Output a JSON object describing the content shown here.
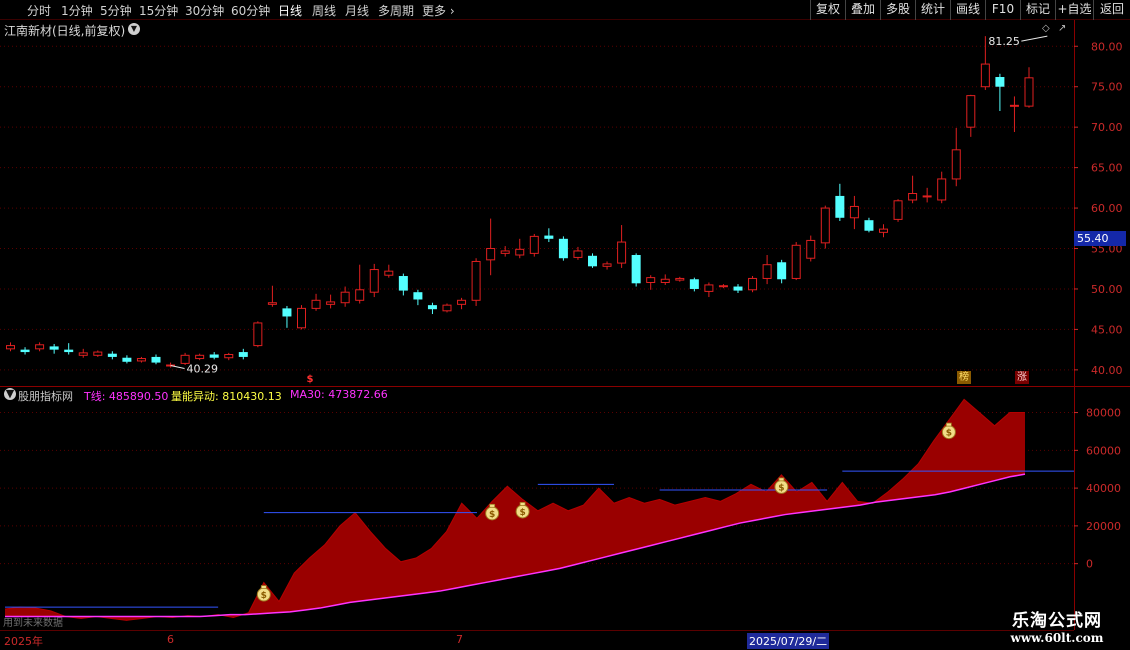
{
  "toolbar": {
    "periods": [
      {
        "label": "分时",
        "active": false
      },
      {
        "label": "1分钟",
        "active": false
      },
      {
        "label": "5分钟",
        "active": false
      },
      {
        "label": "15分钟",
        "active": false
      },
      {
        "label": "30分钟",
        "active": false
      },
      {
        "label": "60分钟",
        "active": false
      },
      {
        "label": "日线",
        "active": true
      },
      {
        "label": "周线",
        "active": false
      },
      {
        "label": "月线",
        "active": false
      },
      {
        "label": "多周期",
        "active": false
      },
      {
        "label": "更多",
        "active": false
      }
    ],
    "buttons": [
      "复权",
      "叠加",
      "多股",
      "统计",
      "画线",
      "F10",
      "标记",
      "+自选",
      "返回"
    ]
  },
  "stock": {
    "title": "江南新材(日线,前复权)",
    "current_price": "55.40",
    "high_label": "81.25",
    "low_label": "40.29"
  },
  "indicator": {
    "name": "股朋指标网",
    "t_line": "T线: 485890.50",
    "volume_spike": "量能异动: 810430.13",
    "ma30": "MA30: 473872.66",
    "no_data_note": "用到未来数据"
  },
  "colors": {
    "up": "#e02020",
    "down": "#54ffff",
    "grid": "#5a0000",
    "t_fill": "#9a0000",
    "ma30": "#ff33ff",
    "level_line": "#3355ff",
    "axis_text": "#cc2a2a",
    "indicator_name": "#c8c8c8",
    "t_label": "#ff33ff",
    "volume_label": "#ffff44"
  },
  "badges": {
    "dollar": "$",
    "bang": "榜",
    "zhang": "涨"
  },
  "dates": {
    "year": "2025年",
    "june": "6",
    "july": "7",
    "cursor": "2025/07/29/二"
  },
  "watermark": {
    "name": "乐淘公式网",
    "url": "www.60lt.com"
  },
  "chart_data": [
    {
      "type": "candlestick",
      "title": "江南新材(日线,前复权)",
      "y_ticks": [
        "40.00",
        "45.00",
        "50.00",
        "55.00",
        "60.00",
        "65.00",
        "70.00",
        "75.00",
        "80.00"
      ],
      "ylim": [
        38.5,
        83
      ],
      "candles": [
        {
          "o": 42.6,
          "c": 43.0,
          "h": 43.4,
          "l": 42.3
        },
        {
          "o": 42.5,
          "c": 42.2,
          "h": 42.8,
          "l": 41.9
        },
        {
          "o": 42.6,
          "c": 43.1,
          "h": 43.4,
          "l": 42.3
        },
        {
          "o": 42.9,
          "c": 42.5,
          "h": 43.2,
          "l": 42.0
        },
        {
          "o": 42.5,
          "c": 42.2,
          "h": 43.3,
          "l": 41.9
        },
        {
          "o": 41.8,
          "c": 42.1,
          "h": 42.6,
          "l": 41.5
        },
        {
          "o": 41.8,
          "c": 42.2,
          "h": 42.4,
          "l": 41.6
        },
        {
          "o": 42.0,
          "c": 41.6,
          "h": 42.3,
          "l": 41.3
        },
        {
          "o": 41.5,
          "c": 41.0,
          "h": 41.8,
          "l": 40.8
        },
        {
          "o": 41.1,
          "c": 41.4,
          "h": 41.6,
          "l": 40.9
        },
        {
          "o": 41.6,
          "c": 40.9,
          "h": 41.9,
          "l": 40.7
        },
        {
          "o": 40.6,
          "c": 40.6,
          "h": 40.9,
          "l": 40.29
        },
        {
          "o": 40.8,
          "c": 41.8,
          "h": 42.1,
          "l": 40.6
        },
        {
          "o": 41.4,
          "c": 41.8,
          "h": 42.0,
          "l": 41.2
        },
        {
          "o": 41.9,
          "c": 41.5,
          "h": 42.2,
          "l": 41.3
        },
        {
          "o": 41.5,
          "c": 41.9,
          "h": 42.1,
          "l": 41.2
        },
        {
          "o": 42.2,
          "c": 41.6,
          "h": 42.6,
          "l": 41.3
        },
        {
          "o": 43.0,
          "c": 45.8,
          "h": 46.0,
          "l": 42.8
        },
        {
          "o": 48.1,
          "c": 48.3,
          "h": 50.4,
          "l": 47.8
        },
        {
          "o": 47.6,
          "c": 46.6,
          "h": 47.9,
          "l": 45.2
        },
        {
          "o": 45.2,
          "c": 47.6,
          "h": 48.0,
          "l": 45.0
        },
        {
          "o": 47.6,
          "c": 48.6,
          "h": 49.4,
          "l": 47.3
        },
        {
          "o": 48.1,
          "c": 48.4,
          "h": 49.3,
          "l": 47.6
        },
        {
          "o": 48.3,
          "c": 49.6,
          "h": 50.3,
          "l": 47.8
        },
        {
          "o": 48.6,
          "c": 49.9,
          "h": 53.0,
          "l": 48.2
        },
        {
          "o": 49.6,
          "c": 52.4,
          "h": 53.1,
          "l": 49.0
        },
        {
          "o": 51.7,
          "c": 52.2,
          "h": 53.0,
          "l": 51.4
        },
        {
          "o": 51.6,
          "c": 49.8,
          "h": 51.9,
          "l": 49.2
        },
        {
          "o": 49.6,
          "c": 48.7,
          "h": 49.9,
          "l": 48.0
        },
        {
          "o": 48.0,
          "c": 47.5,
          "h": 48.3,
          "l": 46.9
        },
        {
          "o": 47.3,
          "c": 48.0,
          "h": 48.2,
          "l": 47.1
        },
        {
          "o": 48.1,
          "c": 48.6,
          "h": 48.9,
          "l": 47.5
        },
        {
          "o": 48.6,
          "c": 53.4,
          "h": 53.8,
          "l": 47.9
        },
        {
          "o": 53.6,
          "c": 55.0,
          "h": 58.7,
          "l": 51.7
        },
        {
          "o": 54.4,
          "c": 54.7,
          "h": 55.3,
          "l": 54.0
        },
        {
          "o": 54.2,
          "c": 54.9,
          "h": 56.2,
          "l": 53.8
        },
        {
          "o": 54.4,
          "c": 56.5,
          "h": 56.8,
          "l": 54.0
        },
        {
          "o": 56.6,
          "c": 56.2,
          "h": 57.5,
          "l": 55.8
        },
        {
          "o": 56.2,
          "c": 53.8,
          "h": 56.5,
          "l": 53.5
        },
        {
          "o": 53.9,
          "c": 54.7,
          "h": 55.2,
          "l": 53.6
        },
        {
          "o": 54.1,
          "c": 52.8,
          "h": 54.4,
          "l": 52.6
        },
        {
          "o": 52.8,
          "c": 53.1,
          "h": 53.4,
          "l": 52.4
        },
        {
          "o": 53.2,
          "c": 55.8,
          "h": 57.9,
          "l": 52.6
        },
        {
          "o": 54.2,
          "c": 50.7,
          "h": 54.4,
          "l": 50.3
        },
        {
          "o": 50.8,
          "c": 51.4,
          "h": 51.7,
          "l": 49.9
        },
        {
          "o": 50.8,
          "c": 51.2,
          "h": 51.8,
          "l": 50.5
        },
        {
          "o": 51.1,
          "c": 51.3,
          "h": 51.5,
          "l": 50.9
        },
        {
          "o": 51.2,
          "c": 50.0,
          "h": 51.4,
          "l": 49.7
        },
        {
          "o": 49.7,
          "c": 50.5,
          "h": 50.8,
          "l": 49.0
        },
        {
          "o": 50.3,
          "c": 50.4,
          "h": 50.6,
          "l": 50.1
        },
        {
          "o": 50.3,
          "c": 49.8,
          "h": 50.6,
          "l": 49.5
        },
        {
          "o": 49.9,
          "c": 51.3,
          "h": 51.6,
          "l": 49.6
        },
        {
          "o": 51.3,
          "c": 53.0,
          "h": 54.2,
          "l": 50.6
        },
        {
          "o": 53.3,
          "c": 51.2,
          "h": 53.6,
          "l": 50.7
        },
        {
          "o": 51.3,
          "c": 55.4,
          "h": 55.8,
          "l": 51.1
        },
        {
          "o": 53.8,
          "c": 56.0,
          "h": 56.6,
          "l": 53.4
        },
        {
          "o": 55.7,
          "c": 60.0,
          "h": 60.3,
          "l": 55.0
        },
        {
          "o": 61.5,
          "c": 58.8,
          "h": 63.0,
          "l": 58.4
        },
        {
          "o": 58.8,
          "c": 60.2,
          "h": 61.5,
          "l": 57.4
        },
        {
          "o": 58.5,
          "c": 57.2,
          "h": 58.8,
          "l": 57.0
        },
        {
          "o": 57.0,
          "c": 57.4,
          "h": 58.0,
          "l": 56.4
        },
        {
          "o": 58.6,
          "c": 60.9,
          "h": 61.1,
          "l": 58.3
        },
        {
          "o": 61.0,
          "c": 61.8,
          "h": 64.0,
          "l": 60.6
        },
        {
          "o": 61.5,
          "c": 61.5,
          "h": 62.5,
          "l": 60.7
        },
        {
          "o": 61.0,
          "c": 63.6,
          "h": 64.5,
          "l": 60.6
        },
        {
          "o": 63.6,
          "c": 67.2,
          "h": 69.9,
          "l": 62.7
        },
        {
          "o": 70.0,
          "c": 73.9,
          "h": 74.0,
          "l": 68.8
        },
        {
          "o": 75.0,
          "c": 77.8,
          "h": 81.25,
          "l": 74.6
        },
        {
          "o": 76.2,
          "c": 75.0,
          "h": 76.6,
          "l": 72.0
        },
        {
          "o": 72.7,
          "c": 72.7,
          "h": 73.8,
          "l": 69.4
        },
        {
          "o": 72.6,
          "c": 76.1,
          "h": 77.4,
          "l": 72.4
        }
      ]
    },
    {
      "type": "area",
      "title": "股朋指标网",
      "y_ticks": [
        "0",
        "20000",
        "40000",
        "60000",
        "80000"
      ],
      "ylim": [
        -33000,
        93000
      ],
      "series": [
        {
          "name": "T线",
          "values": [
            -24000,
            -23000,
            -23500,
            -25000,
            -28000,
            -29000,
            -28000,
            -29000,
            -30000,
            -29000,
            -28000,
            -28500,
            -27500,
            -28000,
            -27000,
            -28500,
            -26000,
            -10000,
            -20000,
            -5000,
            3000,
            10000,
            20000,
            27000,
            17000,
            8000,
            1000,
            3000,
            8000,
            17000,
            32000,
            24000,
            33000,
            41000,
            34000,
            28000,
            32000,
            28000,
            31000,
            40000,
            32000,
            35000,
            32000,
            34000,
            31000,
            33000,
            35000,
            33000,
            37000,
            42000,
            38000,
            47000,
            38000,
            43000,
            33000,
            43000,
            33000,
            32000,
            38000,
            45000,
            53000,
            65000,
            76000,
            87000,
            80000,
            73000,
            80000,
            80000
          ]
        },
        {
          "name": "MA30",
          "values": [
            -28000,
            -28000,
            -28000,
            -28000,
            -28000,
            -28000,
            -28000,
            -28000,
            -28000,
            -28000,
            -28000,
            -28000,
            -28000,
            -28000,
            -27500,
            -27000,
            -27000,
            -26500,
            -26000,
            -25500,
            -24500,
            -23500,
            -22000,
            -20500,
            -19500,
            -18500,
            -17500,
            -16500,
            -15500,
            -14500,
            -13000,
            -11500,
            -10000,
            -8500,
            -7000,
            -5500,
            -4000,
            -2500,
            -500,
            1500,
            3500,
            5500,
            7500,
            9500,
            11500,
            13500,
            15500,
            17500,
            19500,
            21500,
            23000,
            24500,
            26000,
            27000,
            28000,
            29000,
            30000,
            31000,
            32500,
            33500,
            34500,
            35500,
            36500,
            38000,
            40000,
            42000,
            44000,
            46000,
            47380
          ]
        }
      ],
      "level_lines": [
        {
          "value": -23000,
          "from": 0,
          "to": 14
        },
        {
          "value": 27000,
          "from": 17,
          "to": 31
        },
        {
          "value": 42000,
          "from": 35,
          "to": 40
        },
        {
          "value": 39000,
          "from": 43,
          "to": 54
        },
        {
          "value": 49000,
          "from": 55,
          "to": 74
        }
      ],
      "money_bag_markers": [
        17,
        32,
        34,
        51,
        62
      ]
    }
  ]
}
